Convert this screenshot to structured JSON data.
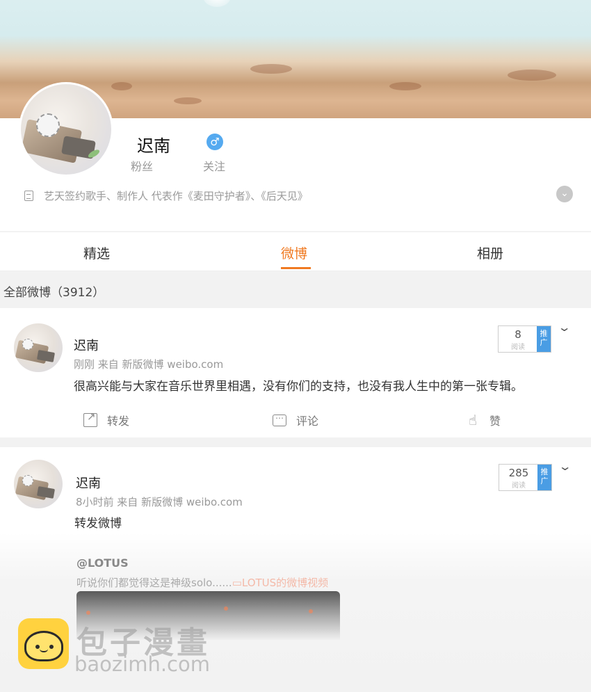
{
  "profile": {
    "name": "迟南",
    "gender_symbol": "♂",
    "stats": {
      "fans_label": "粉丝",
      "follow_label": "关注"
    },
    "bio": "艺天签约歌手、制作人  代表作《麦田守护者》、《后天见》",
    "expand_symbol": "⌄"
  },
  "tabs": [
    {
      "label": "精选",
      "active": false
    },
    {
      "label": "微博",
      "active": true
    },
    {
      "label": "相册",
      "active": false
    }
  ],
  "accent_color": "#f07a22",
  "feed": {
    "count_label": "全部微博（3912）"
  },
  "posts": [
    {
      "author": "迟南",
      "meta": "刚刚 来自 新版微博 weibo.com",
      "text": "很高兴能与大家在音乐世界里相遇，没有你们的支持，也没有我人生中的第一张专辑。",
      "reads": "8",
      "reads_label": "阅读",
      "promo_label": "推广",
      "actions": {
        "share": "转发",
        "comment": "评论",
        "like": "赞"
      }
    },
    {
      "author": "迟南",
      "meta": "8小时前 来自 新版微博 weibo.com",
      "text": "转发微博",
      "reads": "285",
      "reads_label": "阅读",
      "promo_label": "推广",
      "repost": {
        "author": "@LOTUS",
        "text": "听说你们都觉得这是神级solo......",
        "video_link": "LOTUS的微博视频"
      }
    }
  ],
  "watermark": {
    "cn": "包子漫畫",
    "en": "baozimh.com"
  }
}
